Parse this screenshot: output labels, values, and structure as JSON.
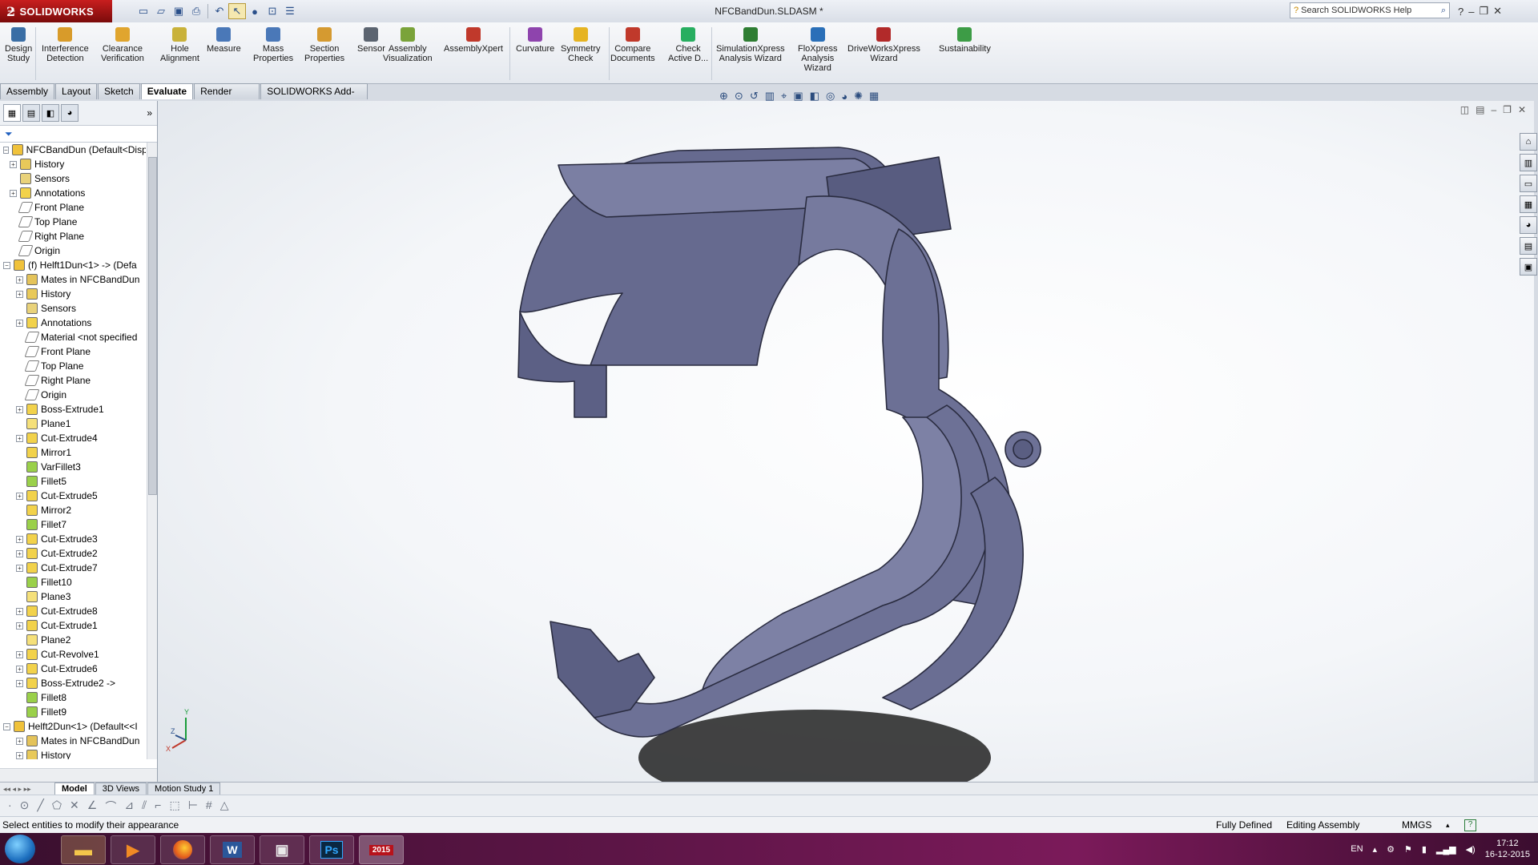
{
  "app": {
    "brand": "SOLIDWORKS",
    "doc_title": "NFCBandDun.SLDASM *"
  },
  "search": {
    "placeholder": "Search SOLIDWORKS Help"
  },
  "quick_access": [
    {
      "icon": "new-icon"
    },
    {
      "icon": "open-icon"
    },
    {
      "icon": "save-icon"
    },
    {
      "icon": "print-icon"
    },
    {
      "icon": "undo-icon"
    },
    {
      "icon": "select-icon"
    },
    {
      "icon": "rebuild-icon"
    },
    {
      "icon": "file-properties-icon"
    },
    {
      "icon": "options-icon"
    }
  ],
  "ribbon": [
    {
      "label": "Design\nStudy",
      "icon": "design-study-icon",
      "color": "#3a6ea5"
    },
    {
      "label": "Interference\nDetection",
      "icon": "interference-detection-icon",
      "color": "#d89b2a"
    },
    {
      "label": "Clearance\nVerification",
      "icon": "clearance-verification-icon",
      "color": "#e0a52e"
    },
    {
      "label": "Hole\nAlignment",
      "icon": "hole-alignment-icon",
      "color": "#c9b23a"
    },
    {
      "label": "Measure",
      "icon": "measure-icon",
      "color": "#4a78b8"
    },
    {
      "label": "Mass\nProperties",
      "icon": "mass-properties-icon",
      "color": "#4a78b8"
    },
    {
      "label": "Section\nProperties",
      "icon": "section-properties-icon",
      "color": "#d59a30"
    },
    {
      "label": "Sensor",
      "icon": "sensor-icon",
      "color": "#5b6470"
    },
    {
      "label": "Assembly\nVisualization",
      "icon": "assembly-visualization-icon",
      "color": "#7aa33a"
    },
    {
      "label": "AssemblyXpert",
      "icon": "assemblyxpert-icon",
      "color": "#c0392b"
    },
    {
      "label": "Curvature",
      "icon": "curvature-icon",
      "color": "#8e44ad"
    },
    {
      "label": "Symmetry\nCheck",
      "icon": "symmetry-check-icon",
      "color": "#e6b422"
    },
    {
      "label": "Compare\nDocuments",
      "icon": "compare-documents-icon",
      "color": "#c0392b"
    },
    {
      "label": "Check\nActive D...",
      "icon": "check-active-document-icon",
      "color": "#27ae60"
    },
    {
      "label": "SimulationXpress\nAnalysis Wizard",
      "icon": "simulationxpress-icon",
      "color": "#2e7d32"
    },
    {
      "label": "FloXpress\nAnalysis\nWizard",
      "icon": "floxpress-icon",
      "color": "#2a6fb8"
    },
    {
      "label": "DriveWorksXpress\nWizard",
      "icon": "driveworksxpress-icon",
      "color": "#b22a2a"
    },
    {
      "label": "Sustainability",
      "icon": "sustainability-icon",
      "color": "#3d9c46"
    }
  ],
  "tabs": [
    "Assembly",
    "Layout",
    "Sketch",
    "Evaluate",
    "Render Tools",
    "SOLIDWORKS Add-Ins"
  ],
  "active_tab": "Evaluate",
  "tree": [
    {
      "label": "NFCBandDun  (Default<Displa",
      "icon": "assembly-icon",
      "indent": 0,
      "expander": "minus"
    },
    {
      "label": "History",
      "icon": "history-icon",
      "indent": 1,
      "expander": "plus"
    },
    {
      "label": "Sensors",
      "icon": "sensors-icon",
      "indent": 1,
      "expander": ""
    },
    {
      "label": "Annotations",
      "icon": "annotations-icon",
      "indent": 1,
      "expander": "plus"
    },
    {
      "label": "Front Plane",
      "icon": "plane-icon",
      "indent": 1,
      "expander": ""
    },
    {
      "label": "Top Plane",
      "icon": "plane-icon",
      "indent": 1,
      "expander": ""
    },
    {
      "label": "Right Plane",
      "icon": "plane-icon",
      "indent": 1,
      "expander": ""
    },
    {
      "label": "Origin",
      "icon": "origin-icon",
      "indent": 1,
      "expander": ""
    },
    {
      "label": "(f) Helft1Dun<1> -> (Defa",
      "icon": "part-icon",
      "indent": 0,
      "expander": "minus"
    },
    {
      "label": "Mates in NFCBandDun",
      "icon": "mates-icon",
      "indent": 2,
      "expander": "plus"
    },
    {
      "label": "History",
      "icon": "history-icon",
      "indent": 2,
      "expander": "plus"
    },
    {
      "label": "Sensors",
      "icon": "sensors-icon",
      "indent": 2,
      "expander": ""
    },
    {
      "label": "Annotations",
      "icon": "annotations-icon",
      "indent": 2,
      "expander": "plus"
    },
    {
      "label": "Material <not specified",
      "icon": "material-icon",
      "indent": 2,
      "expander": ""
    },
    {
      "label": "Front Plane",
      "icon": "plane-icon",
      "indent": 2,
      "expander": ""
    },
    {
      "label": "Top Plane",
      "icon": "plane-icon",
      "indent": 2,
      "expander": ""
    },
    {
      "label": "Right Plane",
      "icon": "plane-icon",
      "indent": 2,
      "expander": ""
    },
    {
      "label": "Origin",
      "icon": "origin-icon",
      "indent": 2,
      "expander": ""
    },
    {
      "label": "Boss-Extrude1",
      "icon": "extrude-icon",
      "indent": 2,
      "expander": "plus"
    },
    {
      "label": "Plane1",
      "icon": "plane-feature-icon",
      "indent": 2,
      "expander": ""
    },
    {
      "label": "Cut-Extrude4",
      "icon": "extrude-icon",
      "indent": 2,
      "expander": "plus"
    },
    {
      "label": "Mirror1",
      "icon": "mirror-icon",
      "indent": 2,
      "expander": ""
    },
    {
      "label": "VarFillet3",
      "icon": "fillet-icon",
      "indent": 2,
      "expander": ""
    },
    {
      "label": "Fillet5",
      "icon": "fillet-icon",
      "indent": 2,
      "expander": ""
    },
    {
      "label": "Cut-Extrude5",
      "icon": "extrude-icon",
      "indent": 2,
      "expander": "plus"
    },
    {
      "label": "Mirror2",
      "icon": "mirror-icon",
      "indent": 2,
      "expander": ""
    },
    {
      "label": "Fillet7",
      "icon": "fillet-icon",
      "indent": 2,
      "expander": ""
    },
    {
      "label": "Cut-Extrude3",
      "icon": "extrude-icon",
      "indent": 2,
      "expander": "plus"
    },
    {
      "label": "Cut-Extrude2",
      "icon": "extrude-icon",
      "indent": 2,
      "expander": "plus"
    },
    {
      "label": "Cut-Extrude7",
      "icon": "extrude-icon",
      "indent": 2,
      "expander": "plus"
    },
    {
      "label": "Fillet10",
      "icon": "fillet-icon",
      "indent": 2,
      "expander": ""
    },
    {
      "label": "Plane3",
      "icon": "plane-feature-icon",
      "indent": 2,
      "expander": ""
    },
    {
      "label": "Cut-Extrude8",
      "icon": "extrude-icon",
      "indent": 2,
      "expander": "plus"
    },
    {
      "label": "Cut-Extrude1",
      "icon": "extrude-icon",
      "indent": 2,
      "expander": "plus"
    },
    {
      "label": "Plane2",
      "icon": "plane-feature-icon",
      "indent": 2,
      "expander": ""
    },
    {
      "label": "Cut-Revolve1",
      "icon": "revolve-icon",
      "indent": 2,
      "expander": "plus"
    },
    {
      "label": "Cut-Extrude6",
      "icon": "extrude-icon",
      "indent": 2,
      "expander": "plus"
    },
    {
      "label": "Boss-Extrude2 ->",
      "icon": "extrude-icon",
      "indent": 2,
      "expander": "plus"
    },
    {
      "label": "Fillet8",
      "icon": "fillet-icon",
      "indent": 2,
      "expander": ""
    },
    {
      "label": "Fillet9",
      "icon": "fillet-icon",
      "indent": 2,
      "expander": ""
    },
    {
      "label": "Helft2Dun<1> (Default<<I",
      "icon": "part-icon",
      "indent": 0,
      "expander": "minus"
    },
    {
      "label": "Mates in NFCBandDun",
      "icon": "mates-icon",
      "indent": 2,
      "expander": "plus"
    },
    {
      "label": "History",
      "icon": "history-icon",
      "indent": 2,
      "expander": "plus"
    }
  ],
  "bottom_tabs": [
    "Model",
    "3D Views",
    "Motion Study 1"
  ],
  "active_bottom_tab": "Model",
  "status": {
    "message": "Select entities to modify their appearance",
    "state": "Fully Defined",
    "mode": "Editing Assembly",
    "units": "MMGS"
  },
  "taskbar": {
    "lang": "EN",
    "time": "17:12",
    "date": "16-12-2015",
    "sw_badge": "2015"
  },
  "colors": {
    "model": "#6d7196",
    "model_edge": "#2a2c40",
    "accent": "#b8121b"
  }
}
